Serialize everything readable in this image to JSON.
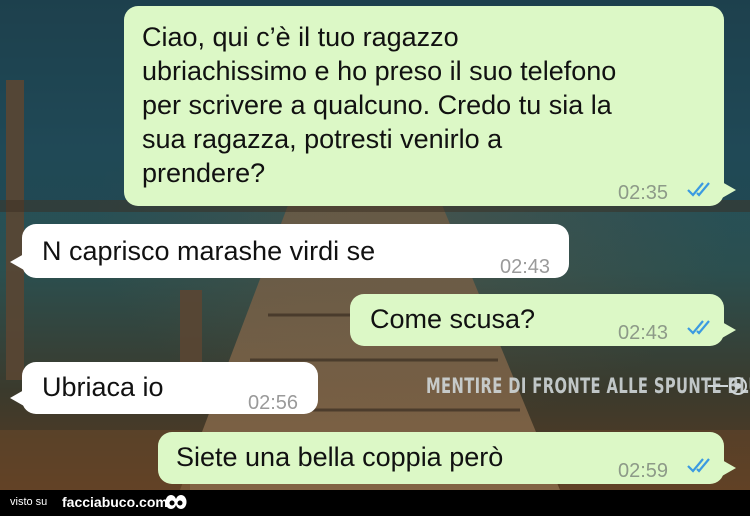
{
  "messages": [
    {
      "id": "m1",
      "direction": "outgoing",
      "text": "Ciao, qui c’è il tuo ragazzo\nubriachissimo e ho preso il suo telefono\nper scrivere a qualcuno. Credo tu sia la\nsua ragazza, potresti venirlo a\nprendere?",
      "time": "02:35",
      "status": "read"
    },
    {
      "id": "m2",
      "direction": "incoming",
      "text": "N caprisco marashe virdi se",
      "time": "02:43"
    },
    {
      "id": "m3",
      "direction": "outgoing",
      "text": "Come scusa?",
      "time": "02:43",
      "status": "read"
    },
    {
      "id": "m4",
      "direction": "incoming",
      "text": "Ubriaca io",
      "time": "02:56"
    },
    {
      "id": "m5",
      "direction": "outgoing",
      "text": "Siete una bella coppia però",
      "time": "02:59",
      "status": "read"
    }
  ],
  "watermark": "MENTIRE DI FRONTE ALLE SPUNTE BLU",
  "footer": {
    "prefix": "visto su",
    "site": "facciabuco.com"
  },
  "colors": {
    "outgoing_bubble": "#dcf8c6",
    "incoming_bubble": "#ffffff",
    "read_ticks": "#3b9ae1",
    "footer_bg": "#000000"
  }
}
